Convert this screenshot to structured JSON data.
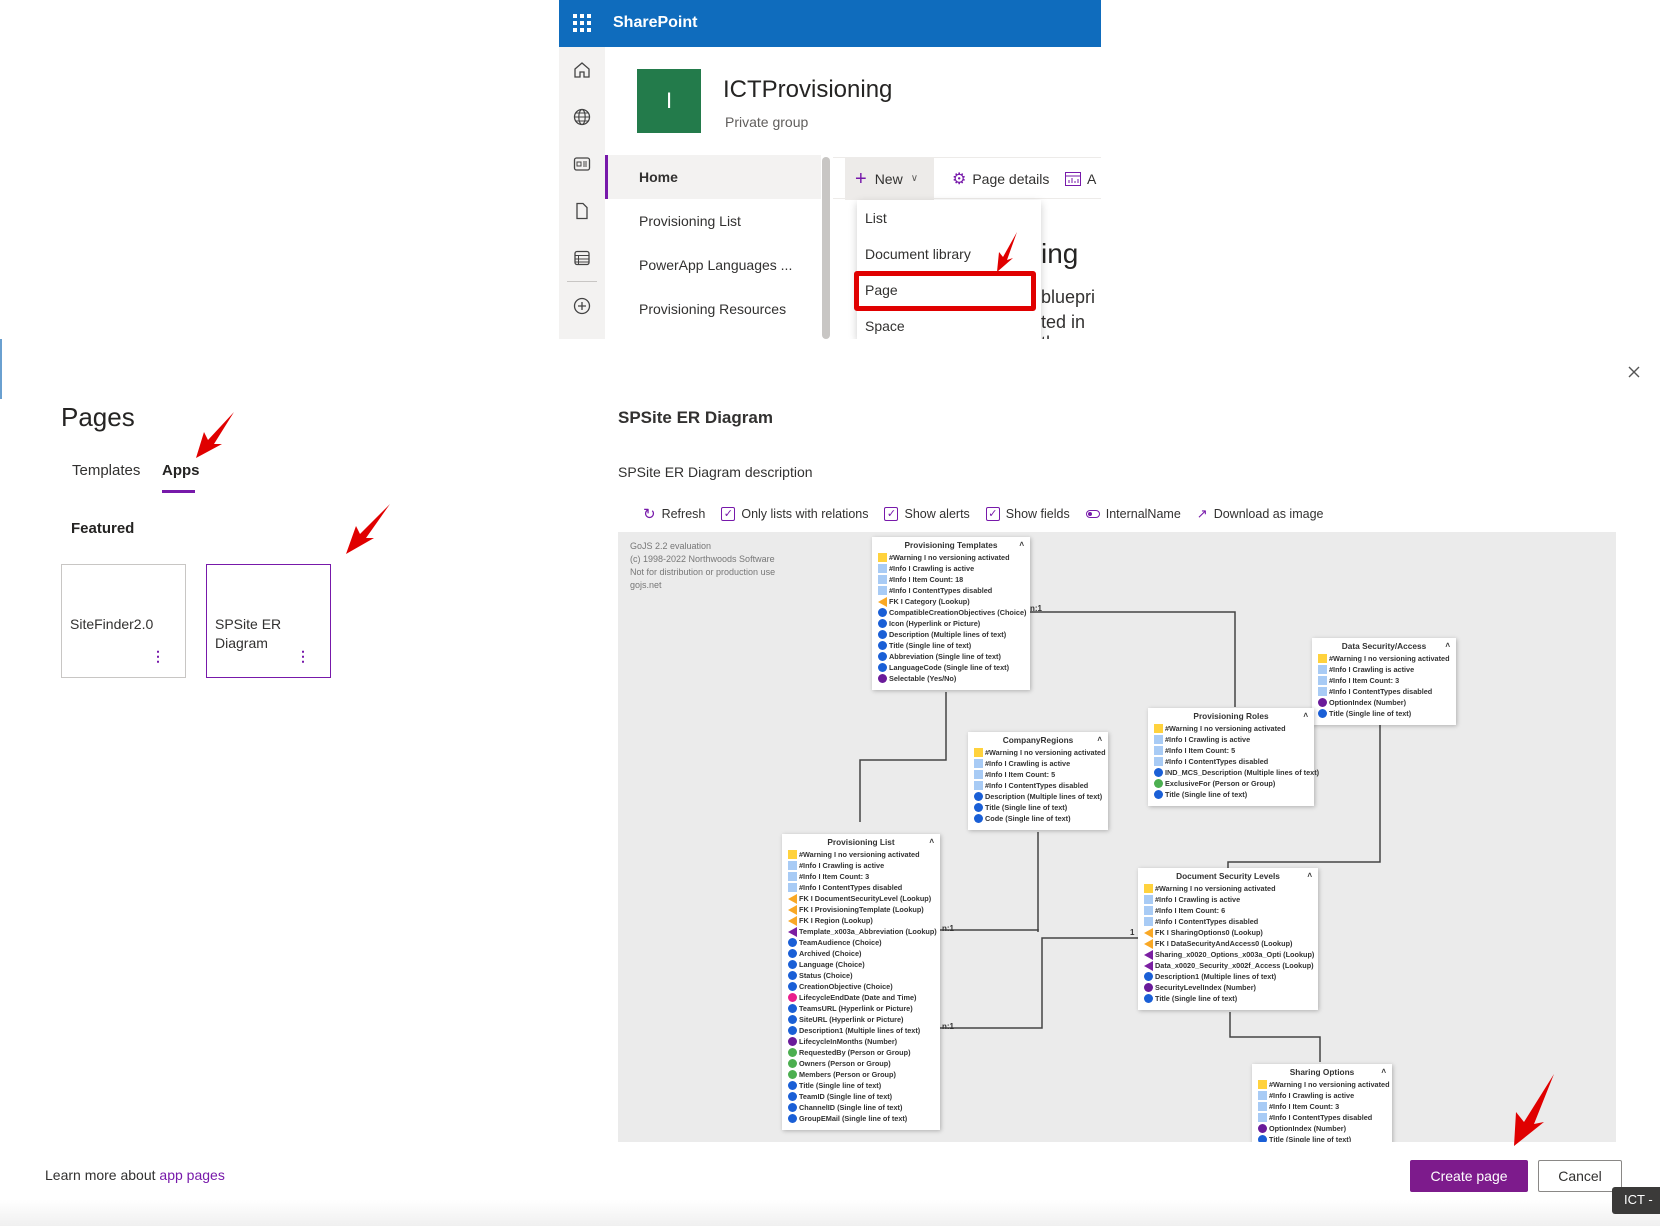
{
  "sharepoint": {
    "brand": "SharePoint",
    "logo_letter": "I",
    "site_name": "ICTProvisioning",
    "site_type": "Private group",
    "nav": [
      "Home",
      "Provisioning List",
      "PowerApp Languages ...",
      "Provisioning Resources"
    ],
    "command_bar": {
      "new": "New",
      "page_details": "Page details",
      "analytics": "A"
    },
    "new_menu": [
      "List",
      "Document library",
      "Page",
      "Space"
    ],
    "background": {
      "title_fragment": "ing",
      "text1": "bluepri",
      "text2": "ted in th"
    }
  },
  "dialog": {
    "title": "Pages",
    "tabs": [
      {
        "label": "Templates",
        "active": false
      },
      {
        "label": "Apps",
        "active": true
      }
    ],
    "section": "Featured",
    "cards": [
      {
        "title": "SiteFinder2.0",
        "selected": false
      },
      {
        "title": "SPSite ER Diagram",
        "selected": true
      }
    ],
    "detail": {
      "title": "SPSite ER Diagram",
      "description": "SPSite ER Diagram description",
      "toolbar": {
        "refresh": "Refresh",
        "only_relations": "Only lists with relations",
        "show_alerts": "Show alerts",
        "show_fields": "Show fields",
        "internal_name": "InternalName",
        "download": "Download as image"
      }
    },
    "learn_more_prefix": "Learn more about",
    "learn_more_link": "app pages",
    "create_button": "Create page",
    "cancel_button": "Cancel",
    "tooltip": "ICT - "
  },
  "diagram": {
    "watermark": [
      "GoJS 2.2 evaluation",
      "(c) 1998-2022 Northwoods Software",
      "Not for distribution or production use",
      "gojs.net"
    ],
    "colors": {
      "warn": "#ffd23d",
      "info": "#a8cbf5",
      "fk": "#f9a825",
      "lookup": "#7b1fa2",
      "text": "#1a5fd6",
      "person": "#4caf50",
      "number": "#6a1b9a",
      "datetime": "#e91e8c",
      "boolean": "#6a1b9a"
    },
    "entities": {
      "provisioning_templates": {
        "title": "Provisioning Templates",
        "rows": [
          [
            "warn",
            "#Warning I no versioning activated"
          ],
          [
            "info",
            "#Info I Crawling is active"
          ],
          [
            "info",
            "#Info I Item Count: 18"
          ],
          [
            "info",
            "#Info I ContentTypes disabled"
          ],
          [
            "fk",
            "FK I Category (Lookup)"
          ],
          [
            "text",
            "CompatibleCreationObjectives (Choice)"
          ],
          [
            "text",
            "Icon (Hyperlink or Picture)"
          ],
          [
            "text",
            "Description (Multiple lines of text)"
          ],
          [
            "text",
            "Title (Single line of text)"
          ],
          [
            "text",
            "Abbreviation (Single line of text)"
          ],
          [
            "text",
            "LanguageCode (Single line of text)"
          ],
          [
            "boolean",
            "Selectable (Yes/No)"
          ]
        ]
      },
      "data_security": {
        "title": "Data Security/Access",
        "rows": [
          [
            "warn",
            "#Warning I no versioning activated"
          ],
          [
            "info",
            "#Info I Crawling is active"
          ],
          [
            "info",
            "#Info I Item Count: 3"
          ],
          [
            "info",
            "#Info I ContentTypes disabled"
          ],
          [
            "number",
            "OptionIndex (Number)"
          ],
          [
            "text",
            "Title (Single line of text)"
          ]
        ]
      },
      "provisioning_roles": {
        "title": "Provisioning Roles",
        "rows": [
          [
            "warn",
            "#Warning I no versioning activated"
          ],
          [
            "info",
            "#Info I Crawling is active"
          ],
          [
            "info",
            "#Info I Item Count: 5"
          ],
          [
            "info",
            "#Info I ContentTypes disabled"
          ],
          [
            "text",
            "IND_MCS_Description (Multiple lines of text)"
          ],
          [
            "person",
            "ExclusiveFor (Person or Group)"
          ],
          [
            "text",
            "Title (Single line of text)"
          ]
        ]
      },
      "company_regions": {
        "title": "CompanyRegions",
        "rows": [
          [
            "warn",
            "#Warning I no versioning activated"
          ],
          [
            "info",
            "#Info I Crawling is active"
          ],
          [
            "info",
            "#Info I Item Count: 5"
          ],
          [
            "info",
            "#Info I ContentTypes disabled"
          ],
          [
            "text",
            "Description (Multiple lines of text)"
          ],
          [
            "text",
            "Title (Single line of text)"
          ],
          [
            "text",
            "Code (Single line of text)"
          ]
        ]
      },
      "provisioning_list": {
        "title": "Provisioning List",
        "rows": [
          [
            "warn",
            "#Warning I no versioning activated"
          ],
          [
            "info",
            "#Info I Crawling is active"
          ],
          [
            "info",
            "#Info I Item Count: 3"
          ],
          [
            "info",
            "#Info I ContentTypes disabled"
          ],
          [
            "fk",
            "FK I DocumentSecurityLevel (Lookup)"
          ],
          [
            "fk",
            "FK I ProvisioningTemplate (Lookup)"
          ],
          [
            "fk",
            "FK I Region (Lookup)"
          ],
          [
            "lookup",
            "Template_x003a_Abbreviation (Lookup)"
          ],
          [
            "text",
            "TeamAudience (Choice)"
          ],
          [
            "text",
            "Archived (Choice)"
          ],
          [
            "text",
            "Language (Choice)"
          ],
          [
            "text",
            "Status (Choice)"
          ],
          [
            "text",
            "CreationObjective (Choice)"
          ],
          [
            "datetime",
            "LifecycleEndDate (Date and Time)"
          ],
          [
            "text",
            "TeamsURL (Hyperlink or Picture)"
          ],
          [
            "text",
            "SiteURL (Hyperlink or Picture)"
          ],
          [
            "text",
            "Description1 (Multiple lines of text)"
          ],
          [
            "number",
            "LifecycleInMonths (Number)"
          ],
          [
            "person",
            "RequestedBy (Person or Group)"
          ],
          [
            "person",
            "Owners (Person or Group)"
          ],
          [
            "person",
            "Members (Person or Group)"
          ],
          [
            "text",
            "Title (Single line of text)"
          ],
          [
            "text",
            "TeamID (Single line of text)"
          ],
          [
            "text",
            "ChannelID (Single line of text)"
          ],
          [
            "text",
            "GroupEMail (Single line of text)"
          ]
        ]
      },
      "document_security": {
        "title": "Document Security Levels",
        "rows": [
          [
            "warn",
            "#Warning I no versioning activated"
          ],
          [
            "info",
            "#Info I Crawling is active"
          ],
          [
            "info",
            "#Info I Item Count: 6"
          ],
          [
            "info",
            "#Info I ContentTypes disabled"
          ],
          [
            "fk",
            "FK I SharingOptions0 (Lookup)"
          ],
          [
            "fk",
            "FK I DataSecurityAndAccess0 (Lookup)"
          ],
          [
            "lookup",
            "Sharing_x0020_Options_x003a_Opti (Lookup)"
          ],
          [
            "lookup",
            "Data_x0020_Security_x002f_Access (Lookup)"
          ],
          [
            "text",
            "Description1 (Multiple lines of text)"
          ],
          [
            "number",
            "SecurityLevelIndex (Number)"
          ],
          [
            "text",
            "Title (Single line of text)"
          ]
        ]
      },
      "sharing_options": {
        "title": "Sharing Options",
        "rows": [
          [
            "warn",
            "#Warning I no versioning activated"
          ],
          [
            "info",
            "#Info I Crawling is active"
          ],
          [
            "info",
            "#Info I Item Count: 3"
          ],
          [
            "info",
            "#Info I ContentTypes disabled"
          ],
          [
            "number",
            "OptionIndex (Number)"
          ],
          [
            "text",
            "Title (Single line of text)"
          ]
        ]
      }
    },
    "relations": {
      "many": "n:1",
      "one": "1"
    }
  }
}
